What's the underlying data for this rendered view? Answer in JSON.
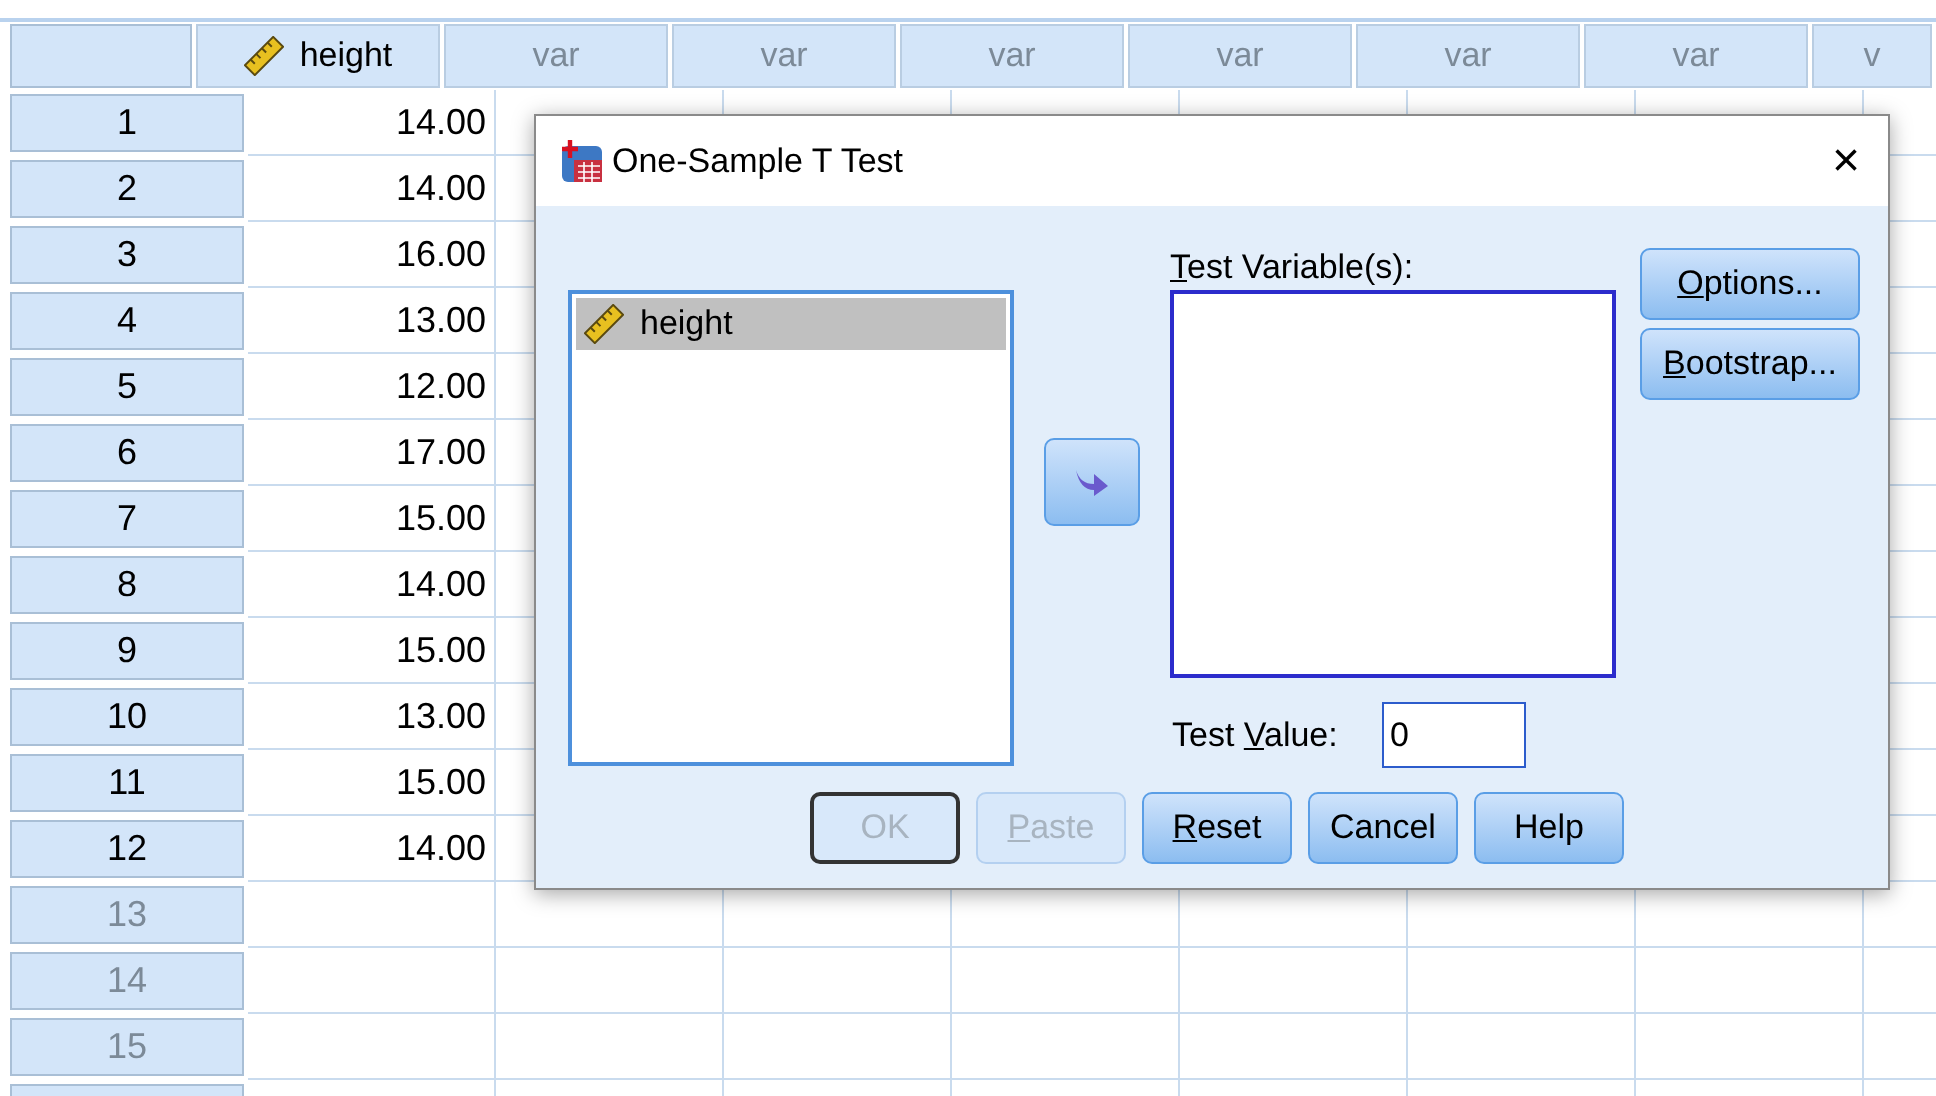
{
  "grid": {
    "columns": [
      {
        "label": "height",
        "dimmed": false,
        "kind": "scale"
      },
      {
        "label": "var",
        "dimmed": true
      },
      {
        "label": "var",
        "dimmed": true
      },
      {
        "label": "var",
        "dimmed": true
      },
      {
        "label": "var",
        "dimmed": true
      },
      {
        "label": "var",
        "dimmed": true
      },
      {
        "label": "var",
        "dimmed": true
      },
      {
        "label": "v",
        "dimmed": true
      }
    ],
    "rows": [
      {
        "label": "1",
        "dimmed": false,
        "value": "14.00"
      },
      {
        "label": "2",
        "dimmed": false,
        "value": "14.00"
      },
      {
        "label": "3",
        "dimmed": false,
        "value": "16.00"
      },
      {
        "label": "4",
        "dimmed": false,
        "value": "13.00"
      },
      {
        "label": "5",
        "dimmed": false,
        "value": "12.00"
      },
      {
        "label": "6",
        "dimmed": false,
        "value": "17.00"
      },
      {
        "label": "7",
        "dimmed": false,
        "value": "15.00"
      },
      {
        "label": "8",
        "dimmed": false,
        "value": "14.00"
      },
      {
        "label": "9",
        "dimmed": false,
        "value": "15.00"
      },
      {
        "label": "10",
        "dimmed": false,
        "value": "13.00"
      },
      {
        "label": "11",
        "dimmed": false,
        "value": "15.00"
      },
      {
        "label": "12",
        "dimmed": false,
        "value": "14.00"
      },
      {
        "label": "13",
        "dimmed": true
      },
      {
        "label": "14",
        "dimmed": true
      },
      {
        "label": "15",
        "dimmed": true
      }
    ]
  },
  "dialog": {
    "title": "One-Sample T Test",
    "close": "×",
    "source_list": [
      {
        "label": "height",
        "kind": "scale",
        "selected": true
      }
    ],
    "test_variables_label": {
      "key": "T",
      "post": "est Variable(s):"
    },
    "test_value_label": {
      "pre": "Test ",
      "key": "V",
      "post": "alue:"
    },
    "test_value": "0",
    "side_buttons": [
      {
        "key": "O",
        "post": "ptions...",
        "disabled": false
      },
      {
        "key": "B",
        "post": "ootstrap...",
        "disabled": false
      }
    ],
    "buttons": [
      {
        "pre": "OK",
        "disabled": true,
        "default": true
      },
      {
        "key": "P",
        "post": "aste",
        "disabled": true,
        "default": false
      },
      {
        "key": "R",
        "post": "eset",
        "disabled": false,
        "default": false
      },
      {
        "pre": "Cancel",
        "disabled": false,
        "default": false
      },
      {
        "pre": "Help",
        "disabled": false,
        "default": false
      }
    ]
  }
}
